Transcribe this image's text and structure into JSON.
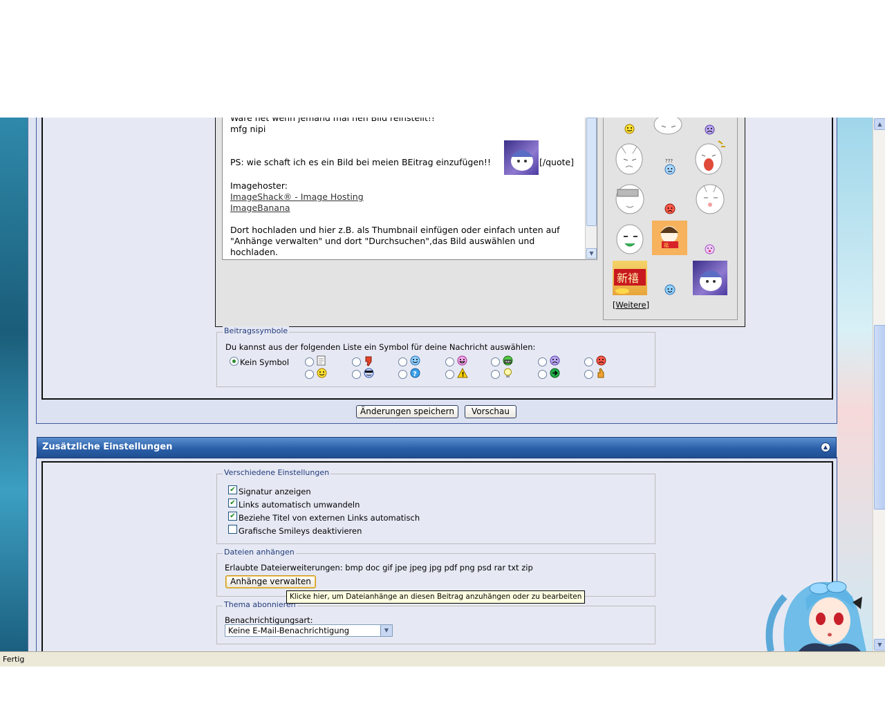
{
  "editor": {
    "lines": {
      "l1": "Wäre net wenn jemand mal nen Bild reinstellt!!",
      "l2": "mfg nipi",
      "l3": "PS: wie schaft ich es ein Bild bei meien BEitrag einzufügen!!",
      "l3_end": "[/quote]",
      "l4": "Imagehoster:",
      "link1": "ImageShack® - Image Hosting",
      "link2": "ImageBanana",
      "l5": "Dort hochladen und hier z.B. als Thumbnail einfügen oder einfach unten auf",
      "l6": "\"Anhänge verwalten\" und dort \"Durchsuchen\",das Bild auswählen und",
      "l7": "hochladen."
    }
  },
  "smilies": {
    "more_label": "Weitere",
    "more_brackets_open": "[",
    "more_brackets_close": "]",
    "chinese_text": "新禧"
  },
  "post_icons": {
    "legend": "Beitragssymbole",
    "description": "Du kannst aus der folgenden Liste ein Symbol für deine Nachricht auswählen:",
    "none_label": "Kein Symbol",
    "icons_row1": [
      "document-icon",
      "thumbs-down-icon",
      "smile-blue-icon",
      "grin-pink-icon",
      "biggrin-green-icon",
      "sad-purple-icon",
      "angry-red-icon"
    ],
    "icons_row2": [
      "smile-yellow-icon",
      "cool-icon",
      "question-icon",
      "warning-icon",
      "lightbulb-icon",
      "arrow-right-icon",
      "thumbs-up-icon"
    ]
  },
  "actions": {
    "save_label": "Änderungen speichern",
    "preview_label": "Vorschau"
  },
  "extra_settings": {
    "title": "Zusätzliche Einstellungen",
    "misc": {
      "legend": "Verschiedene Einstellungen",
      "options": [
        {
          "label": "Signatur anzeigen",
          "checked": true
        },
        {
          "label": "Links automatisch umwandeln",
          "checked": true
        },
        {
          "label": "Beziehe Titel von externen Links automatisch",
          "checked": true
        },
        {
          "label": "Grafische Smileys deaktivieren",
          "checked": false
        }
      ]
    },
    "attachments": {
      "legend": "Dateien anhängen",
      "allowed": "Erlaubte Dateierweiterungen: bmp doc gif jpe jpeg jpg pdf png psd rar txt zip",
      "button": "Anhänge verwalten",
      "tooltip": "Klicke hier, um Dateianhänge an diesen Beitrag anzuhängen oder zu bearbeiten"
    },
    "subscribe": {
      "legend": "Thema abonnieren",
      "label": "Benachrichtigungsart:",
      "selected": "Keine E-Mail-Benachrichtigung"
    }
  },
  "statusbar": {
    "text": "Fertig"
  },
  "colors": {
    "section_bar": "#2a5fa8",
    "legend_text": "#223a7a",
    "border_dark": "#111111"
  }
}
